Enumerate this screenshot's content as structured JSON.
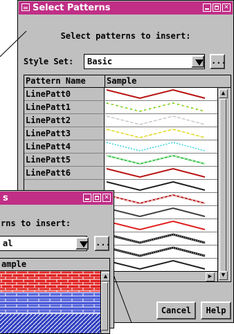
{
  "front_window": {
    "title": "Select Patterns",
    "heading": "Select patterns to insert:",
    "style_set_label": "Style Set:",
    "style_set_value": "Basic",
    "browse_label": "...",
    "columns": [
      "Pattern Name",
      "Sample"
    ],
    "rows": [
      {
        "name": "LinePatt0",
        "color": "#b81414",
        "style": "solid"
      },
      {
        "name": "LinePatt1",
        "color": "#e8e020",
        "style": "dash-green"
      },
      {
        "name": "LinePatt2",
        "color": "#c8c8c8",
        "style": "dash-dark"
      },
      {
        "name": "LinePatt3",
        "color": "#e0d820",
        "style": "dash-dark"
      },
      {
        "name": "LinePatt4",
        "color": "#30d0d8",
        "style": "dotted"
      },
      {
        "name": "LinePatt5",
        "color": "#30c040",
        "style": "dash-white"
      },
      {
        "name": "LinePatt6",
        "color": "#b81414",
        "style": "solid"
      },
      {
        "name": "",
        "color": "#202020",
        "style": "solid"
      },
      {
        "name": "",
        "color": "#b81414",
        "style": "dash-white"
      },
      {
        "name": "",
        "color": "#404040",
        "style": "solid"
      },
      {
        "name": "",
        "color": "#e02020",
        "style": "solid"
      },
      {
        "name": "",
        "color": "#202020",
        "style": "hatched"
      },
      {
        "name": "",
        "color": "#202020",
        "style": "hatched"
      },
      {
        "name": "",
        "color": "#202020",
        "style": "solid"
      }
    ],
    "cancel_label": "Cancel",
    "help_label": "Help"
  },
  "back_window": {
    "title_tail": "s",
    "heading_fragment": "rns to insert:",
    "style_set_fragment": "al",
    "browse_label": "...",
    "column_fragment": "ample",
    "pattern_colors": [
      "#e02020",
      "#4a5ad8",
      "#3040c0"
    ]
  }
}
